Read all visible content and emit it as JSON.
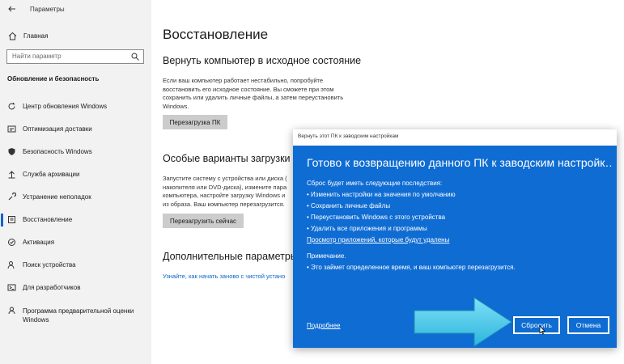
{
  "window": {
    "title": "Параметры"
  },
  "sidebar": {
    "home_label": "Главная",
    "search_placeholder": "Найти параметр",
    "section_title": "Обновление и безопасность",
    "items": [
      {
        "label": "Центр обновления Windows",
        "icon": "refresh-icon"
      },
      {
        "label": "Оптимизация доставки",
        "icon": "delivery-icon"
      },
      {
        "label": "Безопасность Windows",
        "icon": "shield-icon"
      },
      {
        "label": "Служба архивации",
        "icon": "backup-icon"
      },
      {
        "label": "Устранение неполадок",
        "icon": "wrench-icon"
      },
      {
        "label": "Восстановление",
        "icon": "recovery-icon",
        "active": true
      },
      {
        "label": "Активация",
        "icon": "check-circle-icon"
      },
      {
        "label": "Поиск устройства",
        "icon": "person-location-icon"
      },
      {
        "label": "Для разработчиков",
        "icon": "developer-icon"
      },
      {
        "label": "Программа предварительной оценки Windows",
        "icon": "insider-icon"
      }
    ]
  },
  "main": {
    "title": "Восстановление",
    "reset": {
      "heading": "Вернуть компьютер в исходное состояние",
      "description_lines": [
        "Если ваш компьютер работает нестабильно, попробуйте",
        "восстановить его исходное состояние. Вы сможете при этом",
        "сохранить или удалить личные файлы, а затем переустановить",
        "Windows."
      ],
      "button": "Перезагрузка ПК"
    },
    "advanced": {
      "heading": "Особые варианты загрузки",
      "description_lines": [
        "Запустите систему с устройства или диска (",
        "накопителя или DVD-диска), измените пара",
        "компьютера, настройте загрузку Windows и",
        "из образа. Ваш компьютер перезагрузится."
      ],
      "button": "Перезагрузить сейчас"
    },
    "more": {
      "heading": "Дополнительные параметры в",
      "link": "Узнайте, как начать заново с чистой устано"
    }
  },
  "dialog": {
    "titlebar": "Вернуть этот ПК к заводским настройкам",
    "heading": "Готово к возвращению данного ПК к заводским настройк…",
    "consequences_intro": "Сброс будет иметь следующие последствия:",
    "consequences": [
      "• Изменить настройки на значения по умолчанию",
      "• Сохранить личные файлы",
      "• Переустановить Windows с этого устройства",
      "• Удалить все приложения и программы"
    ],
    "apps_link": "Просмотр приложений, которые будут удалены",
    "note_title": "Примечание.",
    "note_text": "• Это займет определенное время, и ваш компьютер перезагрузится.",
    "more_link": "Подробнее",
    "reset_button": "Сбросить",
    "cancel_button": "Отмена"
  },
  "colors": {
    "accent": "#0a64c8",
    "dialog_bg": "#0f6cd2",
    "arrow": "#4cc6e8"
  }
}
